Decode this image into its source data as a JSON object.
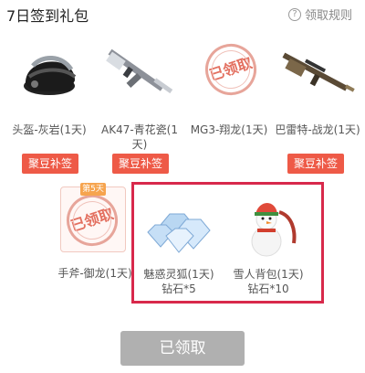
{
  "header": {
    "title": "7日签到礼包",
    "rules_label": "领取规则"
  },
  "items": [
    {
      "label": "头盔-灰岩(1天)",
      "button": "聚豆补签"
    },
    {
      "label": "AK47-青花瓷(1天)",
      "button": "聚豆补签"
    },
    {
      "label": "MG3-翔龙(1天)",
      "stamp": "已领取"
    },
    {
      "label": "巴雷特-战龙(1天)",
      "button": "聚豆补签"
    }
  ],
  "row2": [
    {
      "day": "第5天",
      "label": "手斧-御龙(1天)",
      "stamp": "已领取"
    },
    {
      "label": "魅惑灵狐(1天) 钻石*5"
    },
    {
      "label": "雪人背包(1天) 钻石*10"
    }
  ],
  "claim_button": "已领取"
}
